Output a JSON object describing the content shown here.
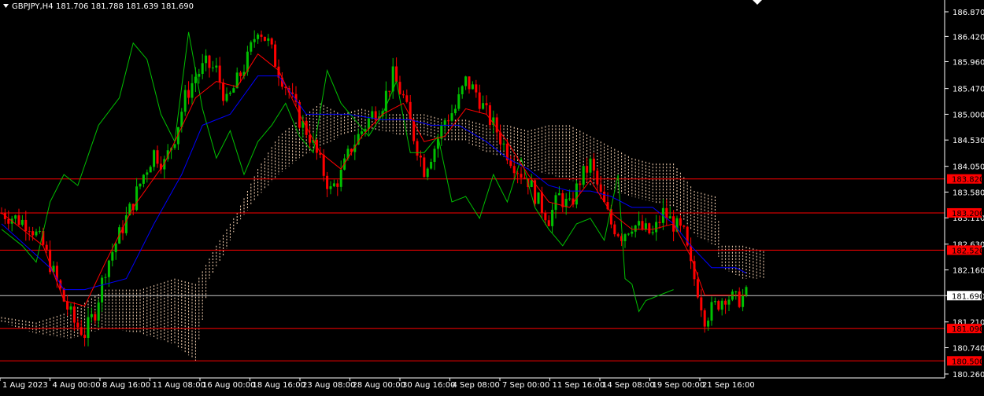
{
  "header": {
    "symbol_label": "GBPJPY,H4",
    "ohlc_label": "181.706 181.788 181.639 181.690"
  },
  "colors": {
    "background": "#000000",
    "axis": "#ffffff",
    "candle_up": "#00c000",
    "candle_down": "#ff0000",
    "tenkan": "#ff0000",
    "kijun": "#0000ff",
    "chikou": "#00c000",
    "kumo": "#ffdab9",
    "hline": "#ff0000",
    "price_line": "#c8c8c8",
    "price_label_bg": "#ffffff",
    "level_label_bg": "#ff0000"
  },
  "chart_data": {
    "type": "candlestick",
    "symbol": "GBPJPY",
    "timeframe": "H4",
    "ohlc_current": {
      "open": 181.706,
      "high": 181.788,
      "low": 181.639,
      "close": 181.69
    },
    "y_ticks": [
      "186.870",
      "186.420",
      "185.960",
      "185.470",
      "185.000",
      "184.530",
      "184.050",
      "183.580",
      "183.110",
      "182.630",
      "182.160",
      "181.690",
      "181.210",
      "180.740",
      "180.260"
    ],
    "ylim": [
      180.26,
      186.87
    ],
    "x_ticks": [
      "1 Aug 2023",
      "4 Aug 00:00",
      "8 Aug 16:00",
      "11 Aug 08:00",
      "16 Aug 00:00",
      "18 Aug 16:00",
      "23 Aug 08:00",
      "28 Aug 00:00",
      "30 Aug 16:00",
      "4 Sep 08:00",
      "7 Sep 00:00",
      "11 Sep 16:00",
      "14 Sep 08:00",
      "19 Sep 00:00",
      "21 Sep 16:00"
    ],
    "current_price": {
      "value": 181.69,
      "label": "181.690"
    },
    "horizontal_levels": [
      {
        "value": 183.82,
        "label": "183.820"
      },
      {
        "value": 183.2,
        "label": "183.200"
      },
      {
        "value": 182.52,
        "label": "182.520"
      },
      {
        "value": 181.09,
        "label": "181.090"
      },
      {
        "value": 180.5,
        "label": "180.500"
      }
    ],
    "close_path": [
      [
        0,
        183.2
      ],
      [
        8,
        183.0
      ],
      [
        12,
        182.6
      ],
      [
        15,
        182.1
      ],
      [
        18,
        181.6
      ],
      [
        21,
        181.2
      ],
      [
        24,
        181.0
      ],
      [
        27,
        181.4
      ],
      [
        30,
        182.2
      ],
      [
        34,
        182.8
      ],
      [
        38,
        183.4
      ],
      [
        41,
        183.9
      ],
      [
        44,
        184.3
      ],
      [
        47,
        184.1
      ],
      [
        50,
        184.6
      ],
      [
        53,
        185.3
      ],
      [
        56,
        185.7
      ],
      [
        59,
        185.9
      ],
      [
        62,
        185.8
      ],
      [
        65,
        185.2
      ],
      [
        68,
        185.6
      ],
      [
        71,
        186.0
      ],
      [
        74,
        186.6
      ],
      [
        77,
        186.3
      ],
      [
        80,
        185.8
      ],
      [
        83,
        185.4
      ],
      [
        86,
        184.9
      ],
      [
        89,
        184.6
      ],
      [
        92,
        184.1
      ],
      [
        95,
        183.6
      ],
      [
        98,
        183.9
      ],
      [
        101,
        184.4
      ],
      [
        104,
        184.7
      ],
      [
        107,
        185.0
      ],
      [
        110,
        185.2
      ],
      [
        113,
        185.7
      ],
      [
        116,
        185.3
      ],
      [
        119,
        184.6
      ],
      [
        122,
        184.0
      ],
      [
        125,
        184.4
      ],
      [
        128,
        184.9
      ],
      [
        131,
        185.1
      ],
      [
        134,
        185.6
      ],
      [
        137,
        185.4
      ],
      [
        140,
        185.0
      ],
      [
        143,
        184.7
      ],
      [
        146,
        184.3
      ],
      [
        149,
        184.0
      ],
      [
        152,
        183.8
      ],
      [
        155,
        183.4
      ],
      [
        158,
        183.1
      ],
      [
        161,
        183.5
      ],
      [
        164,
        183.3
      ],
      [
        167,
        183.8
      ],
      [
        170,
        184.1
      ],
      [
        173,
        183.5
      ],
      [
        176,
        183.0
      ],
      [
        179,
        182.8
      ],
      [
        182,
        183.0
      ],
      [
        185,
        182.9
      ],
      [
        188,
        182.8
      ],
      [
        191,
        183.2
      ],
      [
        194,
        183.0
      ],
      [
        197,
        182.8
      ],
      [
        199,
        182.2
      ],
      [
        201,
        181.8
      ],
      [
        203,
        181.3
      ],
      [
        206,
        181.5
      ],
      [
        209,
        181.7
      ],
      [
        212,
        181.6
      ],
      [
        215,
        181.7
      ]
    ],
    "tenkan_sen": [
      [
        0,
        183.2
      ],
      [
        12,
        182.6
      ],
      [
        18,
        181.6
      ],
      [
        24,
        181.5
      ],
      [
        30,
        182.3
      ],
      [
        38,
        183.3
      ],
      [
        47,
        184.1
      ],
      [
        56,
        185.3
      ],
      [
        62,
        185.6
      ],
      [
        68,
        185.5
      ],
      [
        74,
        186.1
      ],
      [
        80,
        185.8
      ],
      [
        86,
        185.0
      ],
      [
        92,
        184.3
      ],
      [
        98,
        184.0
      ],
      [
        104,
        184.6
      ],
      [
        110,
        185.0
      ],
      [
        116,
        185.2
      ],
      [
        122,
        184.5
      ],
      [
        128,
        184.6
      ],
      [
        134,
        185.1
      ],
      [
        140,
        185.0
      ],
      [
        146,
        184.5
      ],
      [
        152,
        183.9
      ],
      [
        158,
        183.4
      ],
      [
        164,
        183.3
      ],
      [
        170,
        183.8
      ],
      [
        176,
        183.2
      ],
      [
        182,
        182.9
      ],
      [
        188,
        182.9
      ],
      [
        194,
        183.0
      ],
      [
        199,
        182.4
      ],
      [
        203,
        181.7
      ],
      [
        209,
        181.7
      ],
      [
        215,
        181.7
      ]
    ],
    "kijun_sen": [
      [
        0,
        183.0
      ],
      [
        14,
        182.2
      ],
      [
        18,
        181.8
      ],
      [
        24,
        181.8
      ],
      [
        36,
        182.0
      ],
      [
        44,
        183.0
      ],
      [
        52,
        183.9
      ],
      [
        58,
        184.8
      ],
      [
        66,
        185.0
      ],
      [
        74,
        185.7
      ],
      [
        80,
        185.7
      ],
      [
        88,
        185.0
      ],
      [
        100,
        185.0
      ],
      [
        110,
        184.9
      ],
      [
        118,
        184.9
      ],
      [
        124,
        184.8
      ],
      [
        132,
        184.8
      ],
      [
        140,
        184.5
      ],
      [
        146,
        184.2
      ],
      [
        152,
        184.0
      ],
      [
        158,
        183.7
      ],
      [
        164,
        183.6
      ],
      [
        170,
        183.6
      ],
      [
        176,
        183.5
      ],
      [
        182,
        183.3
      ],
      [
        188,
        183.3
      ],
      [
        194,
        183.0
      ],
      [
        199,
        182.6
      ],
      [
        205,
        182.2
      ],
      [
        212,
        182.2
      ],
      [
        215,
        182.1
      ]
    ],
    "chikou_span": [
      [
        0,
        182.9
      ],
      [
        6,
        182.6
      ],
      [
        10,
        182.3
      ],
      [
        14,
        183.4
      ],
      [
        18,
        183.9
      ],
      [
        22,
        183.7
      ],
      [
        28,
        184.8
      ],
      [
        34,
        185.3
      ],
      [
        38,
        186.3
      ],
      [
        42,
        186.0
      ],
      [
        46,
        185.0
      ],
      [
        50,
        184.5
      ],
      [
        54,
        186.5
      ],
      [
        58,
        185.1
      ],
      [
        62,
        184.2
      ],
      [
        66,
        184.7
      ],
      [
        70,
        183.9
      ],
      [
        74,
        184.5
      ],
      [
        78,
        184.8
      ],
      [
        82,
        185.2
      ],
      [
        86,
        184.6
      ],
      [
        90,
        184.3
      ],
      [
        94,
        185.8
      ],
      [
        98,
        185.2
      ],
      [
        102,
        184.9
      ],
      [
        106,
        184.6
      ],
      [
        110,
        185.0
      ],
      [
        114,
        185.6
      ],
      [
        118,
        184.3
      ],
      [
        122,
        184.3
      ],
      [
        126,
        184.6
      ],
      [
        130,
        183.4
      ],
      [
        134,
        183.5
      ],
      [
        138,
        183.1
      ],
      [
        142,
        183.9
      ],
      [
        146,
        183.4
      ],
      [
        150,
        184.2
      ],
      [
        154,
        183.3
      ],
      [
        158,
        182.9
      ],
      [
        162,
        182.6
      ],
      [
        166,
        183.0
      ],
      [
        170,
        183.1
      ],
      [
        174,
        182.7
      ],
      [
        178,
        183.9
      ],
      [
        180,
        182.0
      ],
      [
        182,
        181.9
      ],
      [
        184,
        181.4
      ],
      [
        186,
        181.6
      ],
      [
        190,
        181.7
      ],
      [
        194,
        181.8
      ]
    ],
    "kumo_a": [
      [
        0,
        181.3
      ],
      [
        10,
        181.2
      ],
      [
        20,
        181.4
      ],
      [
        30,
        181.8
      ],
      [
        40,
        181.8
      ],
      [
        50,
        182.0
      ],
      [
        56,
        181.9
      ],
      [
        62,
        182.6
      ],
      [
        68,
        183.2
      ],
      [
        74,
        184.0
      ],
      [
        80,
        184.6
      ],
      [
        86,
        184.9
      ],
      [
        92,
        185.2
      ],
      [
        98,
        185.0
      ],
      [
        104,
        185.1
      ],
      [
        110,
        185.0
      ],
      [
        116,
        185.0
      ],
      [
        122,
        185.0
      ],
      [
        128,
        184.9
      ],
      [
        134,
        184.9
      ],
      [
        140,
        184.8
      ],
      [
        146,
        184.8
      ],
      [
        152,
        184.7
      ],
      [
        158,
        184.8
      ],
      [
        164,
        184.8
      ],
      [
        170,
        184.6
      ],
      [
        176,
        184.4
      ],
      [
        182,
        184.2
      ],
      [
        188,
        184.1
      ],
      [
        194,
        184.1
      ],
      [
        200,
        183.6
      ],
      [
        206,
        183.5
      ],
      [
        208,
        182.6
      ],
      [
        214,
        182.6
      ],
      [
        220,
        182.5
      ]
    ],
    "kumo_b": [
      [
        0,
        181.2
      ],
      [
        10,
        181.0
      ],
      [
        20,
        180.9
      ],
      [
        30,
        181.1
      ],
      [
        40,
        181.0
      ],
      [
        50,
        180.8
      ],
      [
        56,
        180.5
      ],
      [
        60,
        182.0
      ],
      [
        64,
        182.4
      ],
      [
        68,
        183.0
      ],
      [
        74,
        183.5
      ],
      [
        80,
        183.9
      ],
      [
        86,
        184.2
      ],
      [
        92,
        184.4
      ],
      [
        98,
        184.6
      ],
      [
        104,
        184.7
      ],
      [
        110,
        184.7
      ],
      [
        116,
        184.6
      ],
      [
        122,
        184.6
      ],
      [
        128,
        184.5
      ],
      [
        134,
        184.5
      ],
      [
        140,
        184.3
      ],
      [
        146,
        184.2
      ],
      [
        152,
        184.0
      ],
      [
        158,
        183.9
      ],
      [
        164,
        183.8
      ],
      [
        170,
        183.7
      ],
      [
        176,
        183.6
      ],
      [
        182,
        183.5
      ],
      [
        188,
        183.4
      ],
      [
        194,
        183.3
      ],
      [
        200,
        182.8
      ],
      [
        206,
        182.6
      ],
      [
        208,
        182.2
      ],
      [
        214,
        182.0
      ],
      [
        220,
        182.0
      ]
    ]
  }
}
